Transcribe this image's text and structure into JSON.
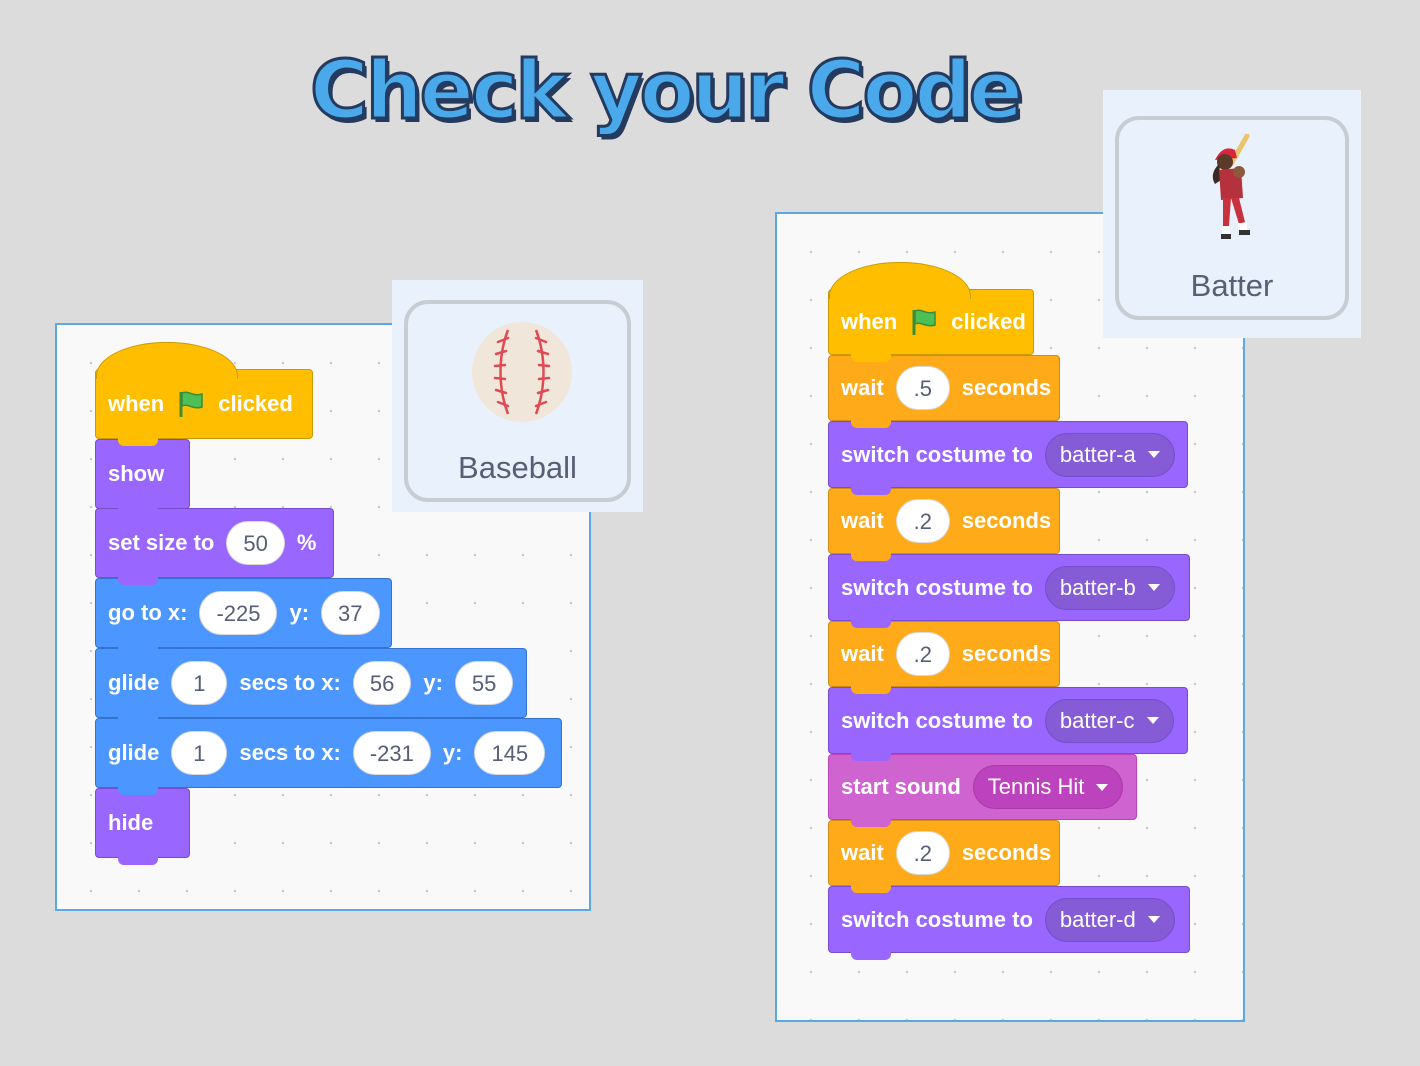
{
  "title": "Check your Code",
  "left_panel": {
    "sprite": {
      "name": "Baseball",
      "icon": "baseball-icon"
    },
    "blocks": [
      {
        "id": "hat",
        "category": "events",
        "parts": [
          "when",
          "flag",
          "clicked"
        ]
      },
      {
        "id": "show",
        "category": "looks",
        "label": "show"
      },
      {
        "id": "set_size",
        "category": "looks",
        "label": "set size to",
        "value": "50",
        "suffix": "%"
      },
      {
        "id": "goto",
        "category": "motion",
        "label": "go to x:",
        "x": "-225",
        "ylabel": "y:",
        "y": "37"
      },
      {
        "id": "glide1",
        "category": "motion",
        "label": "glide",
        "secs": "1",
        "mid": "secs to x:",
        "x": "56",
        "ylabel": "y:",
        "y": "55"
      },
      {
        "id": "glide2",
        "category": "motion",
        "label": "glide",
        "secs": "1",
        "mid": "secs to x:",
        "x": "-231",
        "ylabel": "y:",
        "y": "145"
      },
      {
        "id": "hide",
        "category": "looks",
        "label": "hide"
      }
    ]
  },
  "right_panel": {
    "sprite": {
      "name": "Batter",
      "icon": "batter-icon"
    },
    "blocks": [
      {
        "category": "events",
        "when": "when",
        "clicked": "clicked"
      },
      {
        "category": "control",
        "label": "wait",
        "value": ".5",
        "suffix": "seconds"
      },
      {
        "category": "looks",
        "label": "switch costume to",
        "dropdown": "batter-a"
      },
      {
        "category": "control",
        "label": "wait",
        "value": ".2",
        "suffix": "seconds"
      },
      {
        "category": "looks",
        "label": "switch costume to",
        "dropdown": "batter-b"
      },
      {
        "category": "control",
        "label": "wait",
        "value": ".2",
        "suffix": "seconds"
      },
      {
        "category": "looks",
        "label": "switch costume to",
        "dropdown": "batter-c"
      },
      {
        "category": "sound",
        "label": "start sound",
        "dropdown": "Tennis Hit"
      },
      {
        "category": "control",
        "label": "wait",
        "value": ".2",
        "suffix": "seconds"
      },
      {
        "category": "looks",
        "label": "switch costume to",
        "dropdown": "batter-d"
      }
    ]
  },
  "colors": {
    "events": "#ffbf00",
    "control": "#ffab19",
    "looks": "#9966ff",
    "motion": "#4c97ff",
    "sound": "#cf63cf"
  }
}
